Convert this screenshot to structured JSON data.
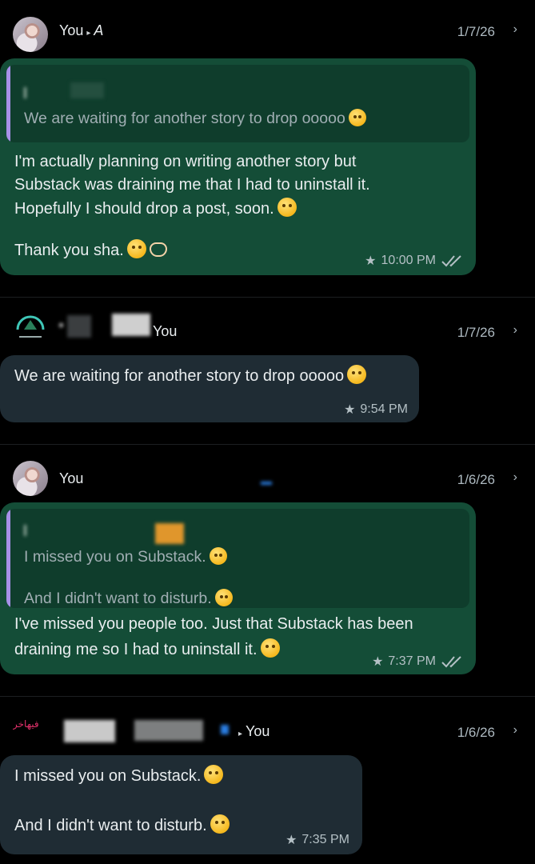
{
  "app": {
    "theme": "dark"
  },
  "colors": {
    "background": "#000000",
    "outgoing_bubble": "#144d37",
    "incoming_bubble": "#1f2c34",
    "quote_accent": "#a791e8",
    "meta_text": "#b4c0c5"
  },
  "items": [
    {
      "header": {
        "sender": "You",
        "recipient_initial": "A",
        "date": "1/7/26"
      },
      "quote": {
        "text": "We are waiting for another story to drop ooooo"
      },
      "message": {
        "lines": [
          "I'm actually planning on writing another story but",
          "Substack was draining me that I had to uninstall it.",
          "Hopefully I should drop a post, soon.",
          "Thank you sha."
        ],
        "time": "10:00 PM",
        "starred": true,
        "status_icon": "double-check-icon"
      }
    },
    {
      "header": {
        "sender": "You",
        "date": "1/7/26"
      },
      "message": {
        "lines": [
          "We are waiting for another story to drop ooooo"
        ],
        "time": "9:54 PM",
        "starred": true
      }
    },
    {
      "header": {
        "sender": "You",
        "date": "1/6/26"
      },
      "quote": {
        "lines": [
          "I missed you on Substack.",
          "And I didn't want to disturb."
        ]
      },
      "message": {
        "lines": [
          "I've missed you people too. Just that Substack has been",
          "draining me so I had to uninstall it."
        ],
        "time": "7:37 PM",
        "starred": true,
        "status_icon": "double-check-icon"
      }
    },
    {
      "header": {
        "sender_logo_text": "فيهاخر",
        "recipient": "You",
        "date": "1/6/26"
      },
      "message": {
        "lines": [
          "I missed you on Substack.",
          "And I didn't want to disturb."
        ],
        "time": "7:35 PM",
        "starred": true
      }
    }
  ],
  "icons": {
    "chevron": "chevron-right-icon",
    "star": "star-icon",
    "read_receipt": "double-check-icon"
  }
}
